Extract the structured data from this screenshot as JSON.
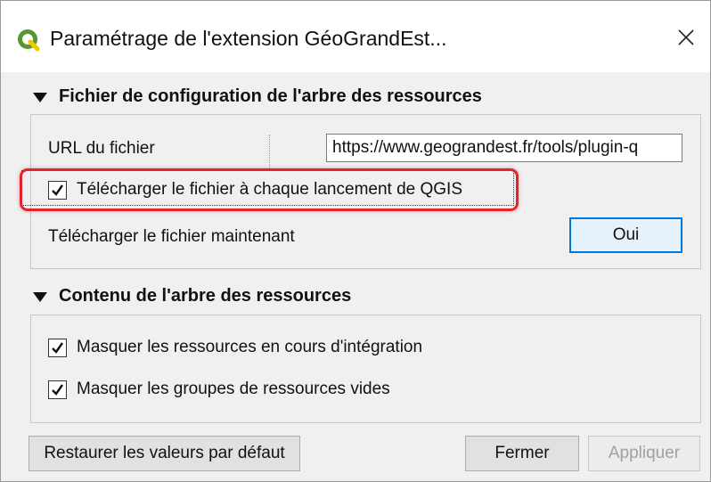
{
  "window": {
    "title": "Paramétrage de l'extension GéoGrandEst...",
    "app_icon": "qgis-logo-icon",
    "close_icon": "close-icon"
  },
  "config_section": {
    "title": "Fichier de configuration de l'arbre des ressources",
    "url_label": "URL du fichier",
    "url_value": "https://www.geograndest.fr/tools/plugin-q",
    "download_on_launch": {
      "label": "Télécharger le fichier à chaque lancement de QGIS",
      "checked": true
    },
    "download_now_label": "Télécharger le fichier maintenant",
    "download_now_button": "Oui"
  },
  "tree_section": {
    "title": "Contenu de l'arbre des ressources",
    "options": [
      {
        "label": "Masquer les ressources en cours d'intégration",
        "checked": true
      },
      {
        "label": "Masquer les groupes de ressources vides",
        "checked": true
      }
    ]
  },
  "footer": {
    "restore_button": "Restaurer les valeurs par défaut",
    "close_button": "Fermer",
    "apply_button": "Appliquer"
  },
  "colors": {
    "highlight": "#e0262c",
    "qgis_green": "#589632",
    "qgis_yellow": "#eec900",
    "default_button_border": "#0078d7"
  }
}
